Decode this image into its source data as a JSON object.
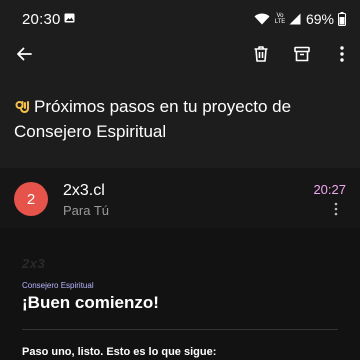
{
  "status_bar": {
    "time": "20:30",
    "volte": "Vo LTE",
    "battery": "69%"
  },
  "toolbar": {
    "icons": [
      "back-arrow-icon",
      "trash-icon",
      "archive-icon",
      "more-vert-icon"
    ]
  },
  "email": {
    "subject": "Próximos pasos en tu proyecto de Consejero Espiritual",
    "subject_emoji": "ok-hand-icon",
    "sender": {
      "avatar_text": "2",
      "avatar_color": "#e5534b",
      "name": "2x3.cl",
      "recipient": "Para Tú",
      "time": "20:27",
      "time_color": "#f1a7f0"
    },
    "body": {
      "logo": "2x3",
      "eyebrow": "Consejero Espiritual",
      "heading": "¡Buen comienzo!",
      "paragraph": "Paso uno, listo. Esto es lo que sigue:"
    }
  },
  "colors": {
    "header_bg": "#1d1d1d",
    "body_bg": "#121212",
    "eyebrow": "#b9b5ff"
  }
}
